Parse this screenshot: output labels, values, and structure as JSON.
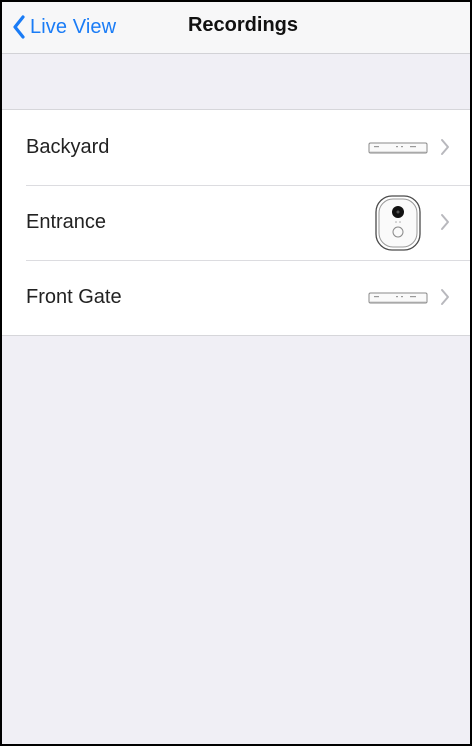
{
  "navbar": {
    "back_label": "Live View",
    "title": "Recordings",
    "back_icon": "chevron-left-icon",
    "accent_color": "#1a7cf6"
  },
  "recordings": {
    "items": [
      {
        "label": "Backyard",
        "thumbnail": "nvr-recorder-icon"
      },
      {
        "label": "Entrance",
        "thumbnail": "doorbell-camera-icon"
      },
      {
        "label": "Front Gate",
        "thumbnail": "nvr-recorder-icon"
      }
    ],
    "disclosure_icon": "chevron-right-icon"
  }
}
